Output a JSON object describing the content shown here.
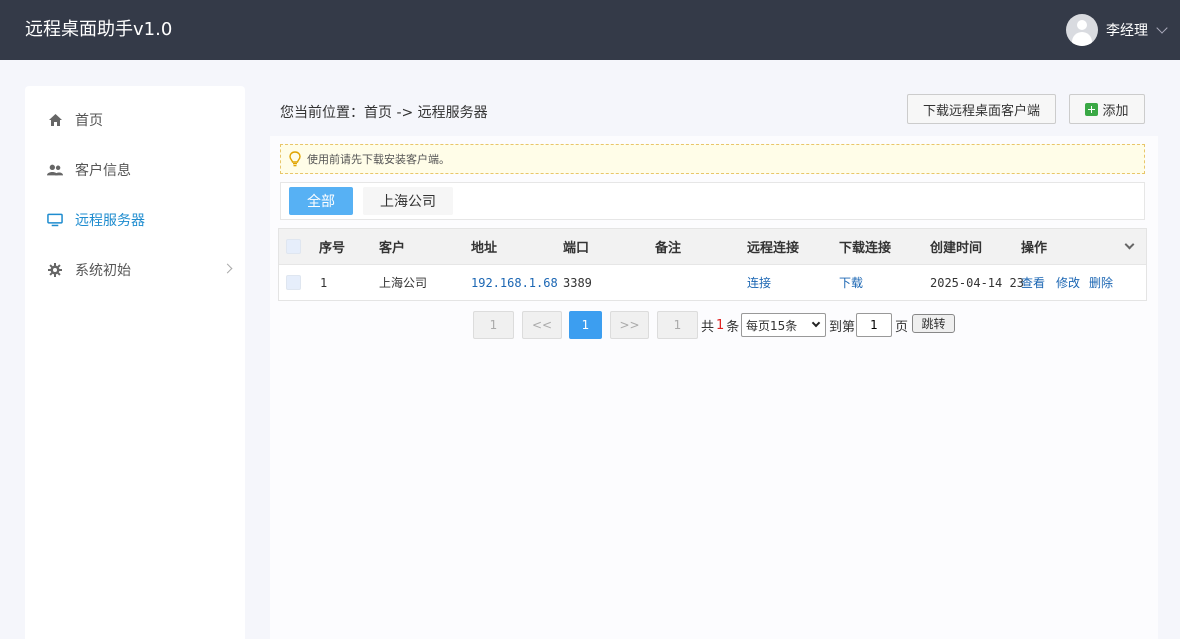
{
  "header": {
    "app_title": "远程桌面助手v1.0",
    "user_name": "李经理"
  },
  "sidebar": {
    "items": [
      {
        "label": "首页",
        "icon": "home-icon"
      },
      {
        "label": "客户信息",
        "icon": "users-icon"
      },
      {
        "label": "远程服务器",
        "icon": "monitor-icon",
        "active": true
      },
      {
        "label": "系统初始",
        "icon": "gear-icon",
        "has_submenu": true
      }
    ]
  },
  "breadcrumb": "您当前位置：首页 -> 远程服务器",
  "toolbar": {
    "download_label": "下载远程桌面客户端",
    "add_label": "添加"
  },
  "notice": "使用前请先下载安装客户端。",
  "filters": {
    "all": "全部",
    "shanghai": "上海公司"
  },
  "table": {
    "columns": [
      "序号",
      "客户",
      "地址",
      "端口",
      "备注",
      "远程连接",
      "下载连接",
      "创建时间",
      "操作"
    ],
    "rows": [
      {
        "no": "1",
        "customer": "上海公司",
        "address": "192.168.1.68",
        "port": "3389",
        "remark": "",
        "connect": "连接",
        "download": "下载",
        "created": "2025-04-14 23",
        "actions": {
          "view": "查看",
          "edit": "修改",
          "delete": "删除"
        }
      }
    ]
  },
  "pager": {
    "first": "1",
    "prev": "<<",
    "current": "1",
    "next": ">>",
    "last": "1",
    "total_prefix": "共",
    "total": "1",
    "total_suffix": "条",
    "page_size": "每页15条",
    "goto_prefix": "到第",
    "goto_value": "1",
    "goto_suffix": "页",
    "jump_label": "跳转"
  },
  "colors": {
    "header_bg": "#343a48",
    "accent": "#3c9ef0",
    "active_nav": "#1e8ccf",
    "link": "#1b66b3"
  }
}
